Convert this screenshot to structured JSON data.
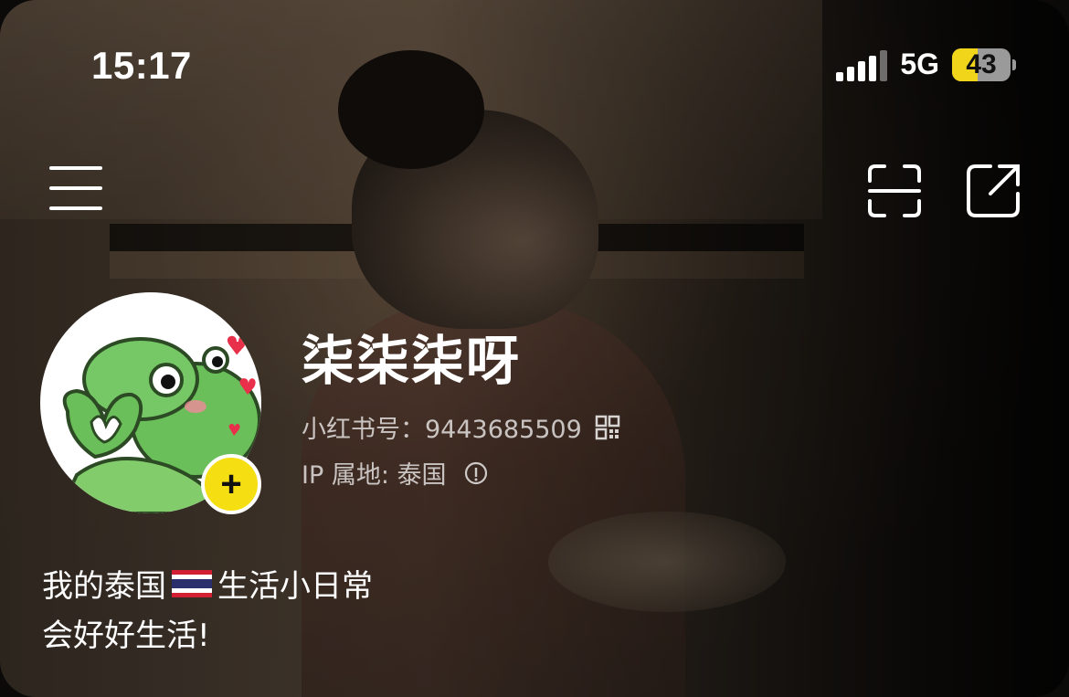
{
  "status_bar": {
    "time": "15:17",
    "network": "5G",
    "battery_level": "43",
    "battery_fraction": 0.43,
    "battery_color": "#f1d51a"
  },
  "nav": {
    "menu_icon": "menu-icon",
    "scan_icon": "scan-icon",
    "share_icon": "share-icon"
  },
  "profile": {
    "avatar_icon": "frog-heart-avatar",
    "add_icon": "+",
    "nickname": "柒柒柒呀",
    "id_label": "小红书号：9443685509",
    "ip_label": "IP 属地: 泰国",
    "accent_color": "#f5de12"
  },
  "bio": {
    "line1_before_flag": "我的泰国",
    "flag_icon": "thailand-flag",
    "line1_after_flag": "生活小日常",
    "line2": "会好好生活!"
  }
}
